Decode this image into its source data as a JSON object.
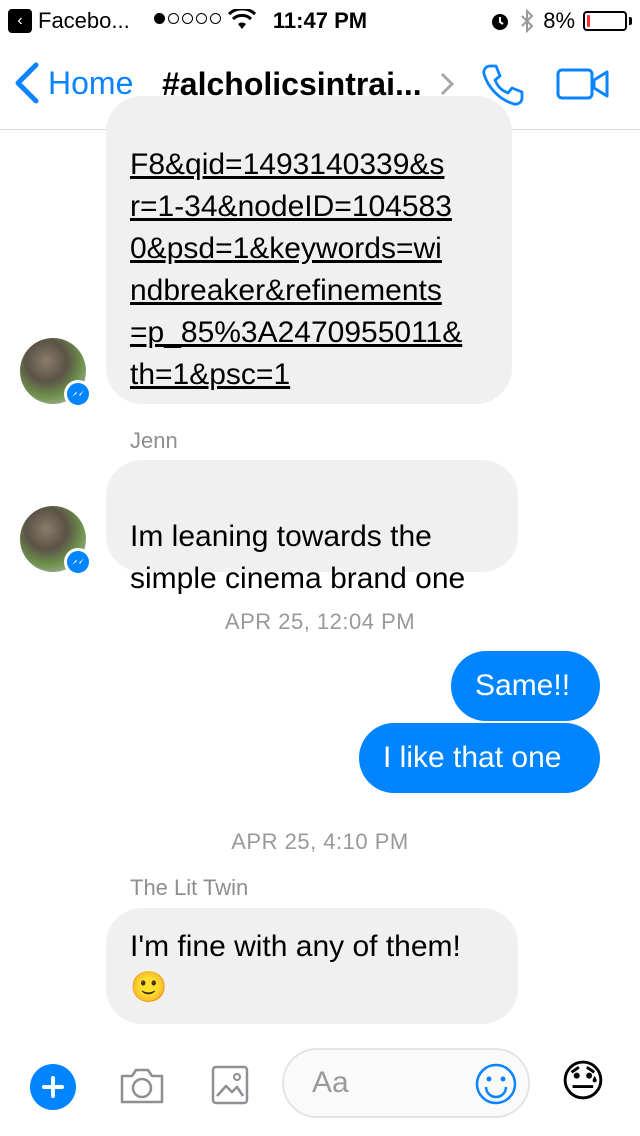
{
  "status_bar": {
    "app_back_label": "Facebo...",
    "time": "11:47 PM",
    "battery": "8%",
    "battery_level": 0.08
  },
  "nav": {
    "back_label": "Home",
    "title": "#alcholicsintrai..."
  },
  "messages": {
    "link_text": "F8&qid=1493140339&s\nr=1-34&nodeID=104583\n0&psd=1&keywords=wi\nndbreaker&refinements\n=p_85%3A2470955011&\nth=1&psc=1",
    "sender_1": "Jenn",
    "msg_1": "Im leaning towards the\nsimple cinema brand one",
    "timestamp_1": "APR 25, 12:04 PM",
    "out_1": "Same!!",
    "out_2": "I like that one",
    "timestamp_2": "APR 25, 4:10 PM",
    "sender_2": "The Lit Twin",
    "msg_2": "I'm fine with any of them!",
    "msg_2_emoji": "🙂"
  },
  "composer": {
    "placeholder": "Aa",
    "quick_emoji": "😓"
  },
  "colors": {
    "accent": "#0084ff",
    "incoming_bubble": "#f1f0f0"
  }
}
